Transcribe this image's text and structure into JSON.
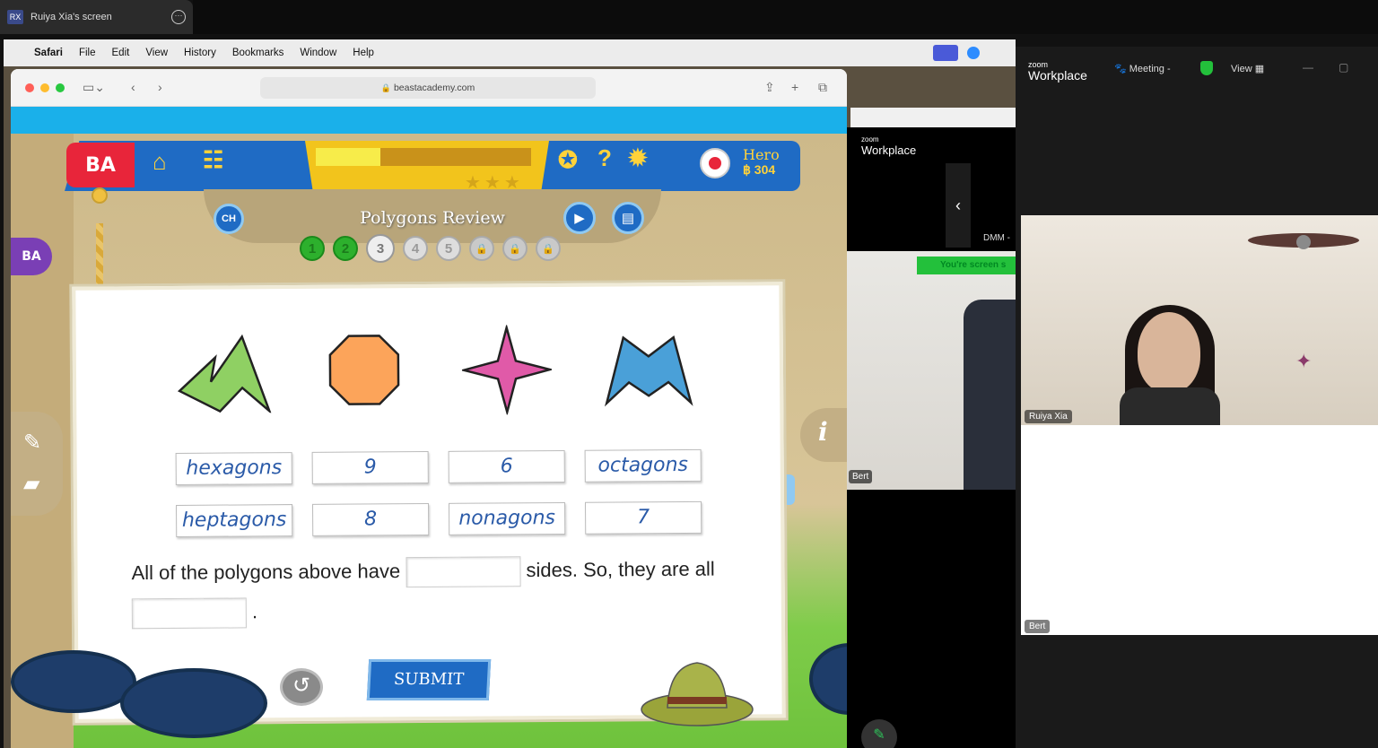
{
  "share_tab": {
    "initials": "RX",
    "title": "Ruiya Xia's screen"
  },
  "menubar": {
    "app": "Safari",
    "items": [
      "File",
      "Edit",
      "View",
      "History",
      "Bookmarks",
      "Window",
      "Help"
    ]
  },
  "safari": {
    "url": "beastacademy.com"
  },
  "game": {
    "logo": "BA",
    "side_logo": "BA",
    "chapter_badge": "CH",
    "lesson_title": "Polygons Review",
    "progress_fraction": 0.3,
    "stars": "★★★",
    "hero": {
      "name": "Hero",
      "coins": "฿ 304"
    },
    "steps": [
      {
        "label": "1",
        "state": "done"
      },
      {
        "label": "2",
        "state": "done"
      },
      {
        "label": "3",
        "state": "current"
      },
      {
        "label": "4",
        "state": "open"
      },
      {
        "label": "5",
        "state": "open"
      },
      {
        "label": "🔒",
        "state": "locked"
      },
      {
        "label": "🔒",
        "state": "locked"
      },
      {
        "label": "🔒",
        "state": "locked"
      }
    ],
    "shapes": [
      {
        "name": "green-polygon",
        "color": "#8fd063"
      },
      {
        "name": "orange-octagon",
        "color": "#fca45a"
      },
      {
        "name": "pink-star",
        "color": "#e05aa8"
      },
      {
        "name": "blue-polygon",
        "color": "#4aa0d8"
      }
    ],
    "choices_row1": [
      "hexagons",
      "9",
      "6",
      "octagons"
    ],
    "choices_row2": [
      "heptagons",
      "8",
      "nonagons",
      "7"
    ],
    "question_part1": "All of the polygons above have",
    "question_part2": "sides. So, they are all",
    "question_end": ".",
    "submit_label": "SUBMIT",
    "reset_icon": "↺",
    "info_icon": "i"
  },
  "zoom_mini": {
    "brand_small": "zoom",
    "brand": "Workplace",
    "dmm_label": "DMM -",
    "share_note": "You're screen s",
    "bert_label": "Bert",
    "back": "‹"
  },
  "zoom": {
    "brand_small": "zoom",
    "brand": "Workplace",
    "meeting_label": "Meeting -",
    "view_label": "View",
    "participant1": "Ruiya Xia",
    "participant2": "Bert"
  }
}
